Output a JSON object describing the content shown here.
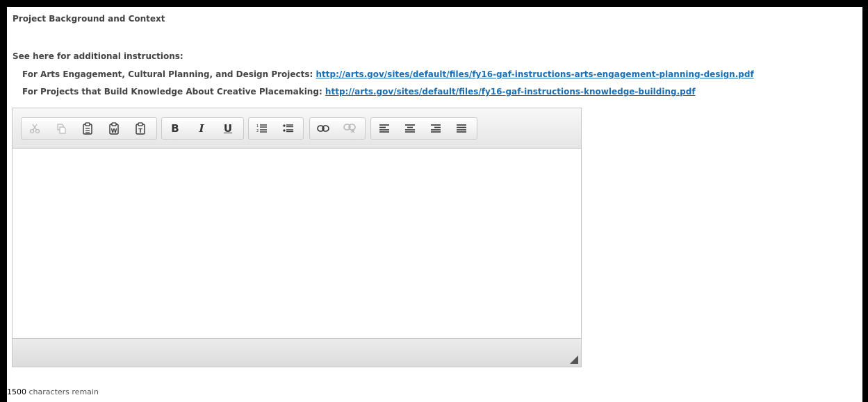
{
  "section": {
    "title": "Project Background and Context",
    "instructions_heading": "See here for additional instructions:"
  },
  "links": [
    {
      "prefix": "For Arts Engagement, Cultural Planning, and Design Projects: ",
      "url_text": "http://arts.gov/sites/default/files/fy16-gaf-instructions-arts-engagement-planning-design.pdf"
    },
    {
      "prefix": "For Projects that Build Knowledge About Creative Placemaking: ",
      "url_text": "http://arts.gov/sites/default/files/fy16-gaf-instructions-knowledge-building.pdf"
    }
  ],
  "toolbar": {
    "cut_icon": "✂",
    "copy_icon": "⎘",
    "paste_icon": "📋",
    "paste_word_icon": "W",
    "paste_text_icon": "T",
    "bold_label": "B",
    "italic_label": "I",
    "underline_label": "U",
    "ordered_list_icon": "≔",
    "bullet_list_icon": "☰",
    "link_icon": "⛓",
    "unlink_icon": "⛓",
    "align_left_icon": "☰",
    "align_center_icon": "☰",
    "align_right_icon": "☰",
    "justify_icon": "☰"
  },
  "editor": {
    "content": ""
  },
  "char_count": {
    "remaining": "1500",
    "suffix": " characters remain"
  }
}
